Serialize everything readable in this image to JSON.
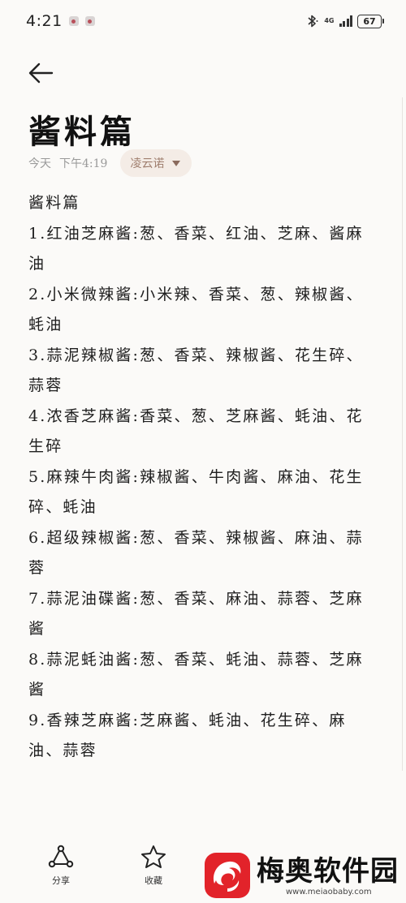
{
  "status_bar": {
    "time": "4:21",
    "network": "4G",
    "battery": "67"
  },
  "note": {
    "title": "酱料篇",
    "date": "今天",
    "time": "下午4:19",
    "folder": "凌云诺",
    "lines": [
      "酱料篇",
      "1.红油芝麻酱:葱、香菜、红油、芝麻、酱麻油",
      "2.小米微辣酱:小米辣、香菜、葱、辣椒酱、蚝油",
      "3.蒜泥辣椒酱:葱、香菜、辣椒酱、花生碎、蒜蓉",
      "4.浓香芝麻酱:香菜、葱、芝麻酱、蚝油、花生碎",
      "5.麻辣牛肉酱:辣椒酱、牛肉酱、麻油、花生碎、蚝油",
      "6.超级辣椒酱:葱、香菜、辣椒酱、麻油、蒜蓉",
      "7.蒜泥油碟酱:葱、香菜、麻油、蒜蓉、芝麻酱",
      "8.蒜泥蚝油酱:葱、香菜、蚝油、蒜蓉、芝麻酱",
      "9.香辣芝麻酱:芝麻酱、蚝油、花生碎、麻油、蒜蓉"
    ]
  },
  "bottom_bar": {
    "share_label": "分享",
    "favorite_label": "收藏"
  },
  "watermark": {
    "name": "梅奥软件园",
    "url": "www.meiaobaby.com"
  },
  "icons": {
    "back": "arrow-left-icon",
    "share": "share-icon",
    "favorite": "star-icon",
    "folder_caret": "caret-down-icon"
  }
}
